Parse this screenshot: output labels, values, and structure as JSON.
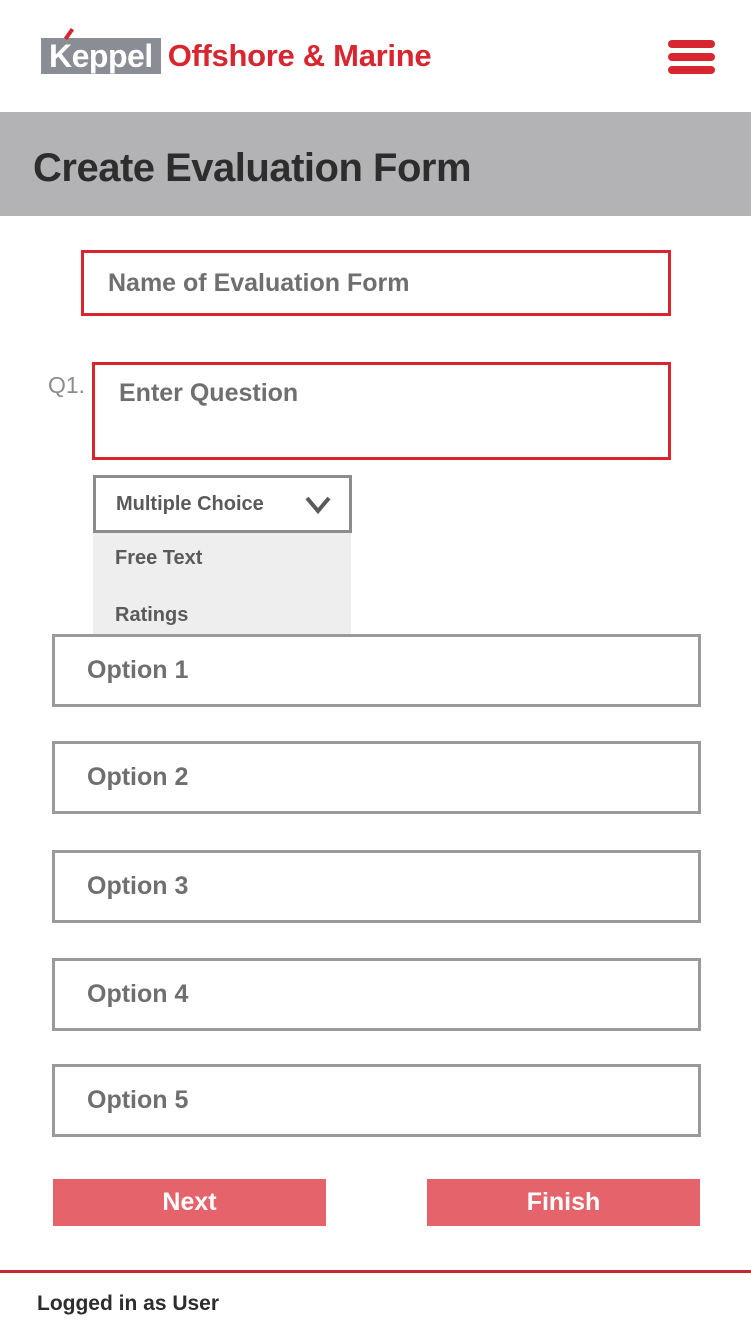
{
  "header": {
    "logo_brand": "Keppel",
    "logo_name": "Offshore & Marine",
    "menu_icon": "hamburger-menu-icon",
    "accent_color": "#d7262f"
  },
  "title_bar": {
    "title": "Create Evaluation Form"
  },
  "form": {
    "name_placeholder": "Name of Evaluation Form",
    "question_label": "Q1.",
    "question_placeholder": "Enter Question",
    "question_type": {
      "selected": "Multiple Choice",
      "options": [
        "Free Text",
        "Ratings"
      ],
      "icon": "chevron-down-icon"
    },
    "options": [
      {
        "placeholder": "Option 1"
      },
      {
        "placeholder": "Option 2"
      },
      {
        "placeholder": "Option 3"
      },
      {
        "placeholder": "Option 4"
      },
      {
        "placeholder": "Option 5"
      }
    ]
  },
  "actions": {
    "next_label": "Next",
    "finish_label": "Finish",
    "button_color": "#e5636a"
  },
  "footer": {
    "status": "Logged in as User"
  }
}
